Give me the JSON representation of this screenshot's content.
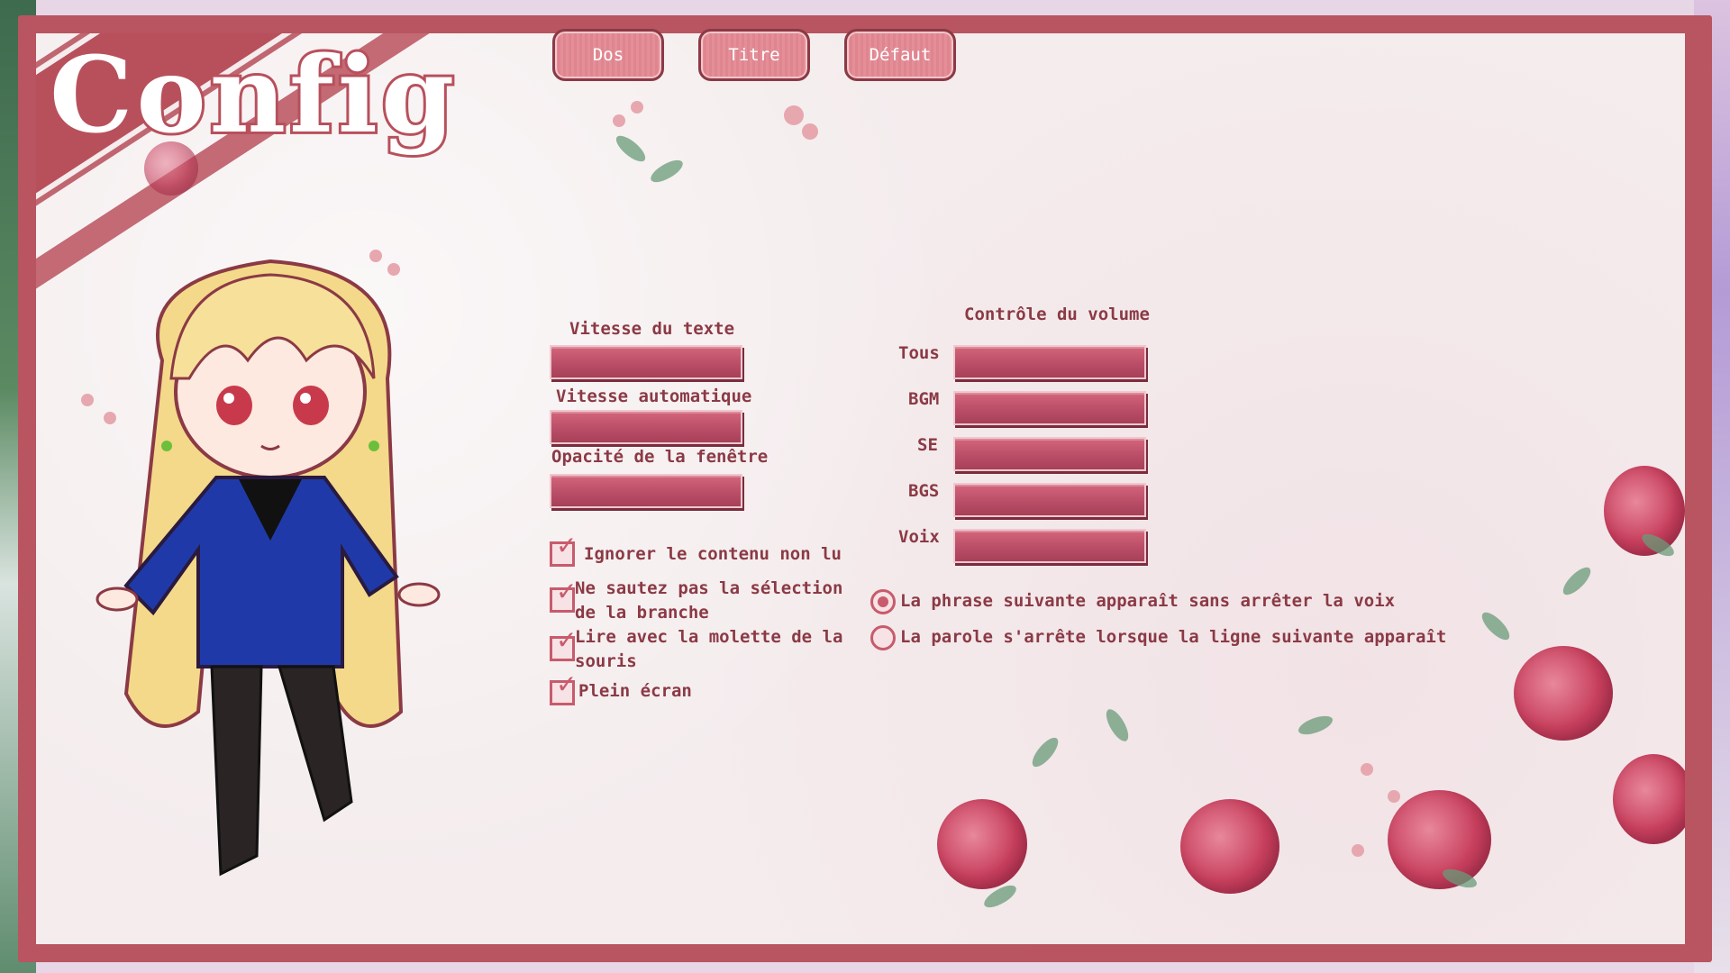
{
  "title": "Config",
  "top_buttons": [
    {
      "label": "Dos"
    },
    {
      "label": "Titre"
    },
    {
      "label": "Défaut"
    }
  ],
  "text_settings": {
    "text_speed_label": "Vitesse du texte",
    "auto_speed_label": "Vitesse automatique",
    "window_opacity_label": "Opacité de la fenêtre"
  },
  "volume": {
    "heading": "Contrôle du volume",
    "channels": [
      {
        "label": "Tous"
      },
      {
        "label": "BGM"
      },
      {
        "label": "SE"
      },
      {
        "label": "BGS"
      },
      {
        "label": "Voix"
      }
    ]
  },
  "checkboxes": [
    {
      "label": "Ignorer le contenu non lu",
      "checked": true
    },
    {
      "label": "Ne sautez pas la sélection de la branche",
      "checked": true
    },
    {
      "label": "Lire avec la molette de la souris",
      "checked": true
    },
    {
      "label": "Plein écran",
      "checked": true
    }
  ],
  "voice_options": [
    {
      "label": "La phrase suivante apparaît sans arrêter la voix",
      "selected": true
    },
    {
      "label": "La parole s'arrête lorsque la ligne suivante apparaît",
      "selected": false
    }
  ],
  "colors": {
    "frame": "#b85560",
    "paper": "#f4eced",
    "accent": "#c85b6c",
    "slider": "#b84c66",
    "text": "#8b3a45"
  }
}
